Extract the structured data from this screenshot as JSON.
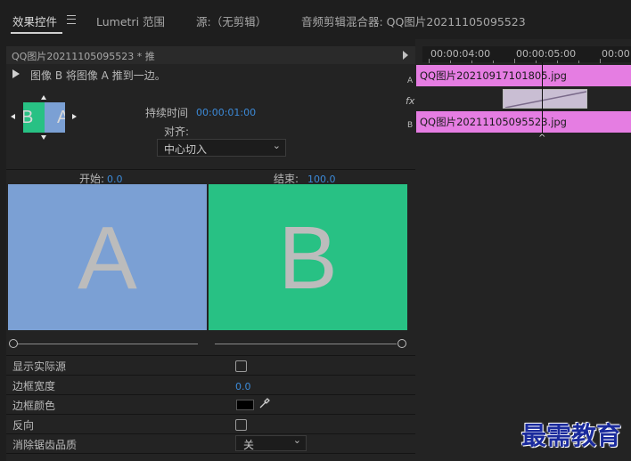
{
  "tabs": [
    {
      "label": "效果控件"
    },
    {
      "label": "Lumetri 范围"
    },
    {
      "label": "源:（无剪辑）"
    },
    {
      "label": "音频剪辑混合器: QQ图片20211105095523"
    }
  ],
  "effect_controls": {
    "header_title": "QQ图片20211105095523 * 推",
    "description": "图像 B 将图像 A 推到一边。",
    "thumb_a": "A",
    "thumb_b": "B",
    "duration_label": "持续时间",
    "duration_value": "00:00:01:00",
    "align_label": "对齐:",
    "align_value": "中心切入",
    "start_label": "开始:",
    "start_value": "0.0",
    "end_label": "结束:",
    "end_value": "100.0",
    "preview_a": "A",
    "preview_b": "B",
    "properties": [
      {
        "label": "显示实际源"
      },
      {
        "label": "边框宽度",
        "value": "0.0"
      },
      {
        "label": "边框颜色"
      },
      {
        "label": "反向"
      },
      {
        "label": "消除锯齿品质",
        "value": "关"
      }
    ]
  },
  "timeline": {
    "ruler": [
      "00:00:04:00",
      "00:00:05:00",
      "00:00"
    ],
    "track_a_label": "A",
    "track_fx_label": "fx",
    "track_b_label": "B",
    "clip_a": "QQ图片20210917101805.jpg",
    "clip_b": "QQ图片20211105095523.jpg"
  },
  "watermark": "最需教育",
  "colors": {
    "panel_bg": "#232323",
    "accent_blue": "#3c8ad8",
    "image_a": "#7ba0d4",
    "image_b": "#28c184",
    "clip": "#e57de2"
  }
}
